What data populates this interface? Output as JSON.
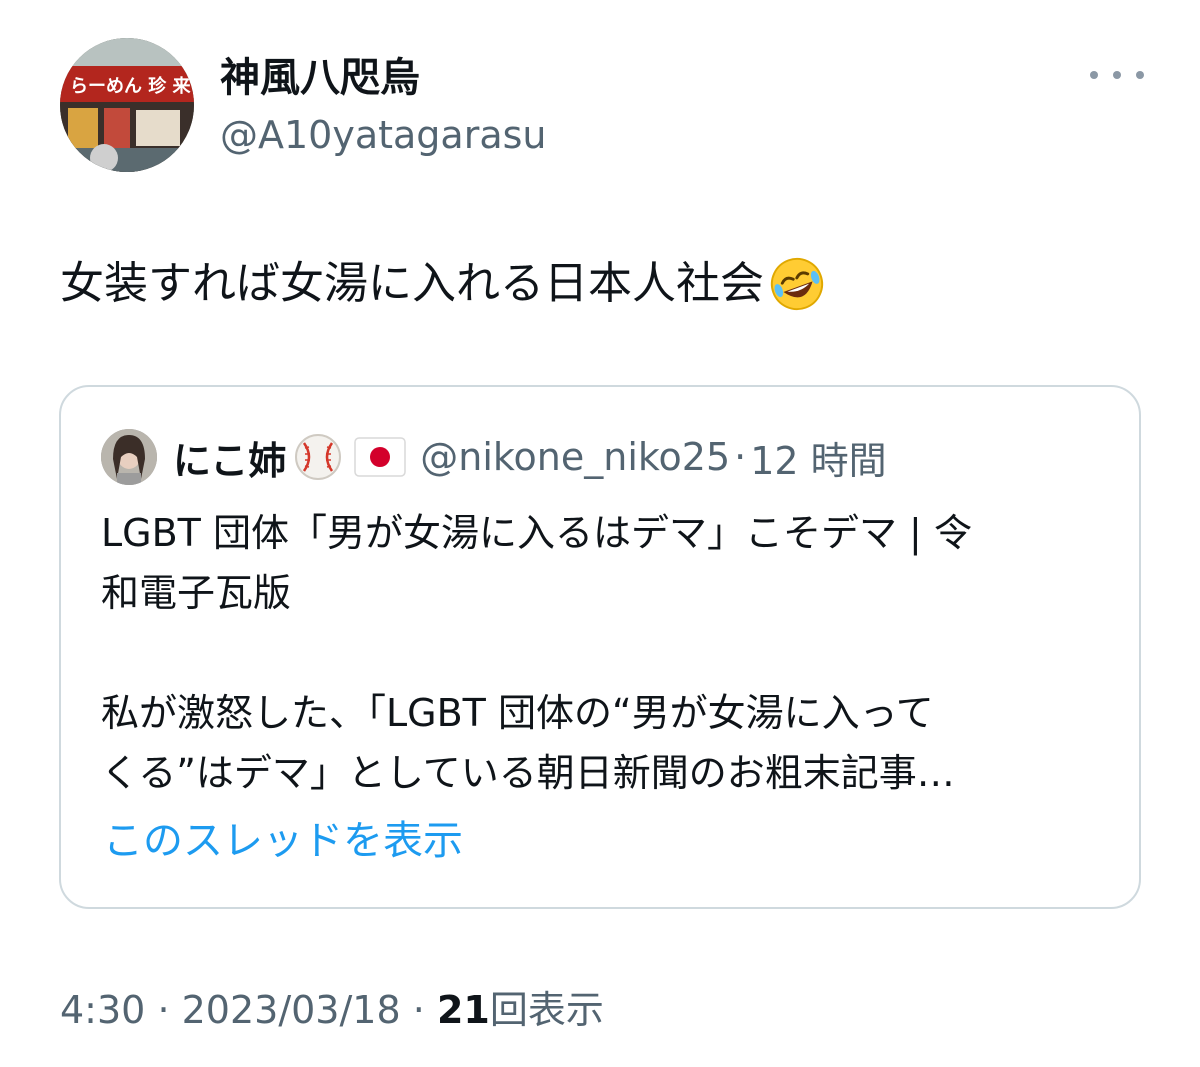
{
  "tweet": {
    "author": {
      "display_name": "神風八咫烏",
      "handle": "@A10yatagarasu",
      "avatar_sign_text": "らーめん 珍 来"
    },
    "more_icon": "more-dots-icon",
    "text": "女装すれば女湯に入れる日本人社会",
    "text_emoji": "rofl-emoji",
    "quote": {
      "display_name": "にこ姉",
      "name_emojis": [
        "baseball-emoji",
        "japan-flag-emoji"
      ],
      "handle": "@nikone_niko25",
      "separator": "·",
      "time": "12 時間",
      "lines": [
        "LGBT 団体「男が女湯に入るはデマ」こそデマ | 令",
        "和電子瓦版",
        "",
        "私が激怒した、「LGBT 団体の“男が女湯に入って",
        "くる”はデマ」としている朝日新聞のお粗末記事…"
      ],
      "show_thread_label": "このスレッドを表示"
    },
    "meta": {
      "time": "4:30",
      "separator": "·",
      "date": "2023/03/18",
      "views_count": "21",
      "views_label": "回表示"
    }
  },
  "colors": {
    "text_primary": "#0f1419",
    "text_secondary": "#536471",
    "link": "#1d9bf0",
    "border": "#cfd9de"
  }
}
